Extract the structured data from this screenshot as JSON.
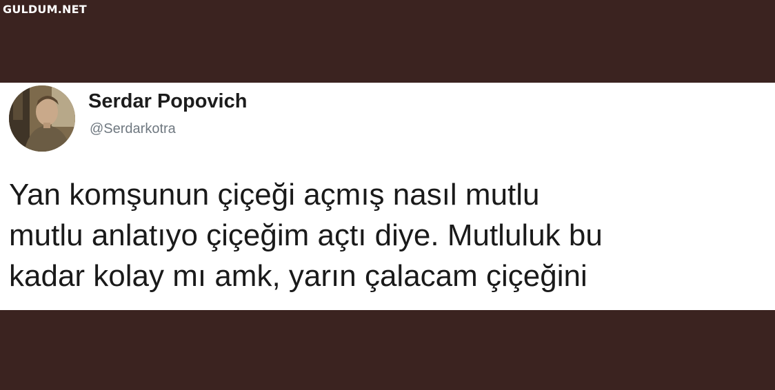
{
  "watermark": "GULDUM.NET",
  "tweet": {
    "author_name": "Serdar Popovich",
    "author_handle": "@Serdarkotra",
    "text_lines": [
      "Yan komşunun çiçeği açmış nasıl mutlu",
      "mutlu anlatıyo çiçeğim açtı diye. Mutluluk bu",
      "kadar kolay mı amk, yarın çalacam çiçeğini"
    ]
  }
}
